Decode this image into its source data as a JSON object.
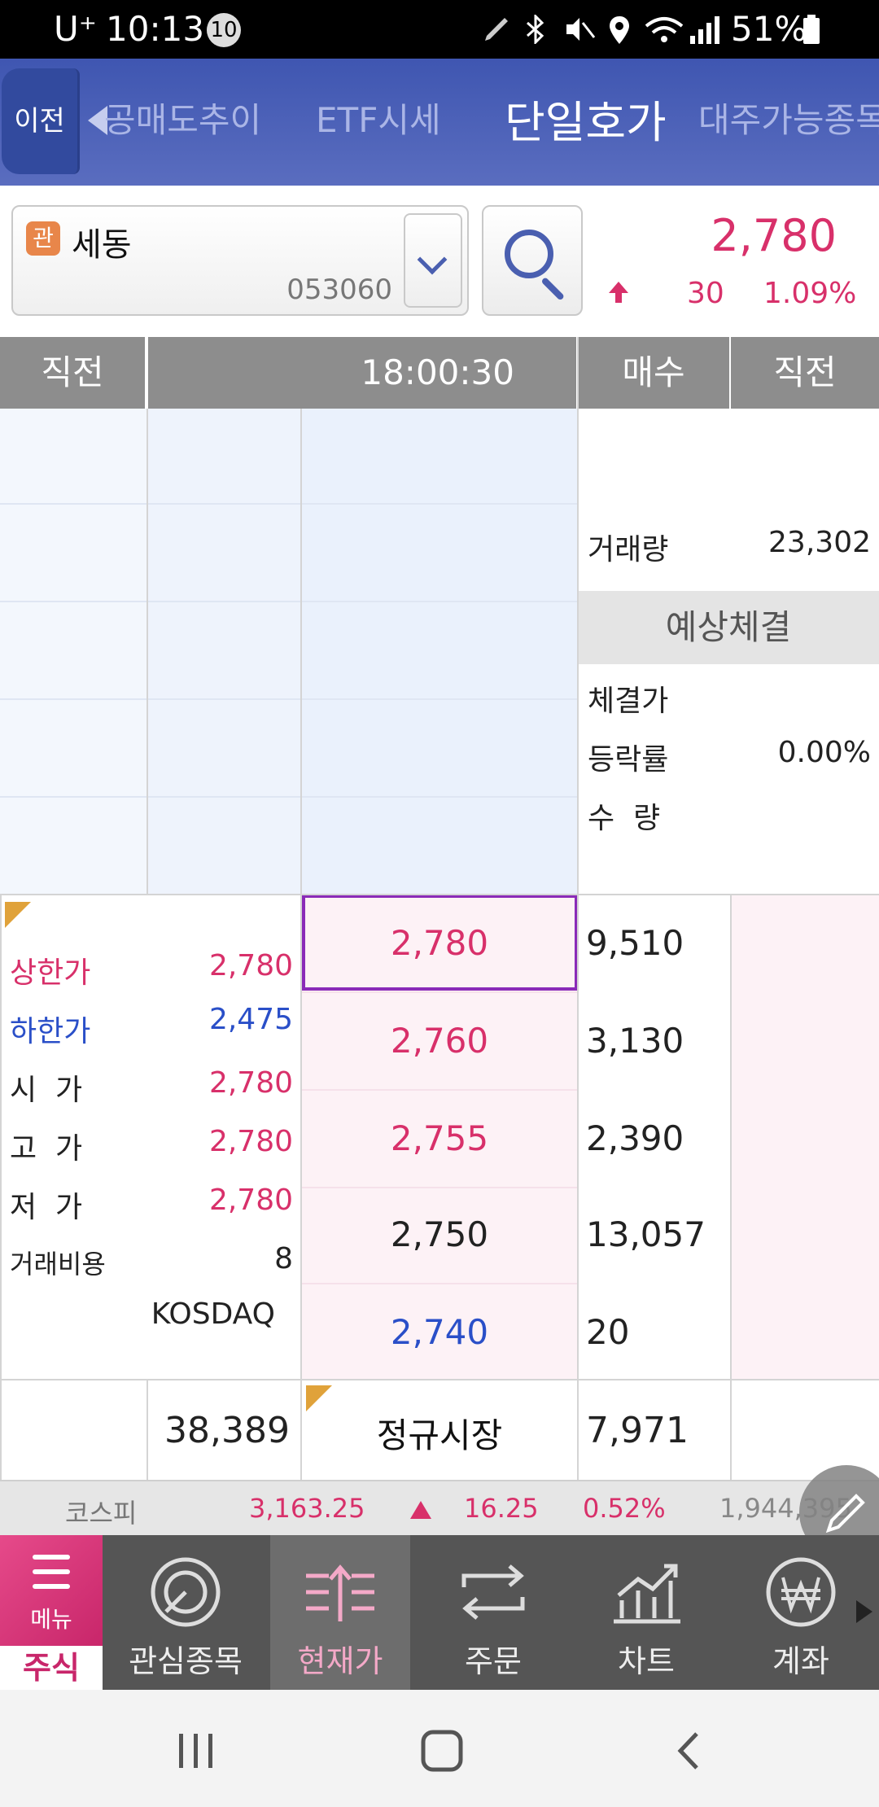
{
  "status_bar": {
    "carrier": "U⁺",
    "time": "10:13",
    "notif_count": "10",
    "battery": "51%"
  },
  "tabbar": {
    "prev_label": "이전",
    "tabs": [
      {
        "label": "공매도추이"
      },
      {
        "label": "ETF시세"
      },
      {
        "label": "단일호가"
      },
      {
        "label": "대주가능종목"
      }
    ]
  },
  "stock": {
    "badge": "관",
    "name": "세동",
    "code": "053060",
    "price": "2,780",
    "change": "30",
    "change_pct": "1.09%"
  },
  "grid": {
    "headers": {
      "prev_left": "직전",
      "time": "18:00:30",
      "bid": "매수",
      "prev_right": "직전"
    },
    "volume_label": "거래량",
    "volume": "23,302",
    "expected_header": "예상체결",
    "exp_price_label": "체결가",
    "exp_rate_label": "등락률",
    "exp_rate": "0.00%",
    "exp_qty_label": "수  량",
    "info": [
      {
        "label": "상한가",
        "value": "2,780"
      },
      {
        "label": "하한가",
        "value": "2,475"
      },
      {
        "label": "시  가",
        "value": "2,780"
      },
      {
        "label": "고  가",
        "value": "2,780"
      },
      {
        "label": "저  가",
        "value": "2,780"
      },
      {
        "label": "거래비용",
        "value": "8"
      }
    ],
    "market": "KOSDAQ",
    "bids": [
      {
        "price": "2,780",
        "qty": "9,510"
      },
      {
        "price": "2,760",
        "qty": "3,130"
      },
      {
        "price": "2,755",
        "qty": "2,390"
      },
      {
        "price": "2,750",
        "qty": "13,057"
      },
      {
        "price": "2,740",
        "qty": "20"
      }
    ],
    "total_ask": "38,389",
    "session": "정규시장",
    "total_bid": "7,971"
  },
  "index_bar": {
    "name": "코스피",
    "value": "3,163.25",
    "change": "16.25",
    "pct": "0.52%",
    "volume": "1,944,395"
  },
  "bottom_nav": {
    "menu_label": "메뉴",
    "stock_label": "주식",
    "items": [
      {
        "label": "관심종목"
      },
      {
        "label": "현재가"
      },
      {
        "label": "주문"
      },
      {
        "label": "차트"
      },
      {
        "label": "계좌"
      }
    ]
  },
  "colors": {
    "up": "#d8306a",
    "down": "#2a4fc8",
    "header_blue": "#4a5fb0"
  }
}
